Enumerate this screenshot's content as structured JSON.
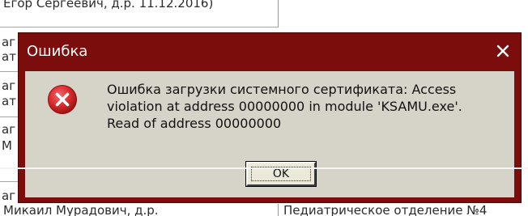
{
  "background": {
    "top_row_text": "Егор Сергеевич, д.р. 11.12.2016)",
    "left_column_fragments": [
      "аг",
      "ат",
      "аг",
      "ат",
      "аг",
      "М",
      "аг"
    ],
    "bottom_left_text": "Микаил Мурадович, д.р.",
    "bottom_right_text": "Педиатрическое отделение №4"
  },
  "dialog": {
    "title": "Ошибка",
    "close_glyph": "×",
    "icon": "error-icon",
    "message_lines": [
      "Ошибка загрузки системного сертификата: Access",
      "violation at address 00000000 in module 'KSAMU.exe'.",
      "Read of address 00000000"
    ],
    "ok_label": "OK"
  },
  "colors": {
    "title_bar": "#7b0d0d",
    "dialog_body": "#d6d3c8",
    "error_red": "#d8282b"
  }
}
